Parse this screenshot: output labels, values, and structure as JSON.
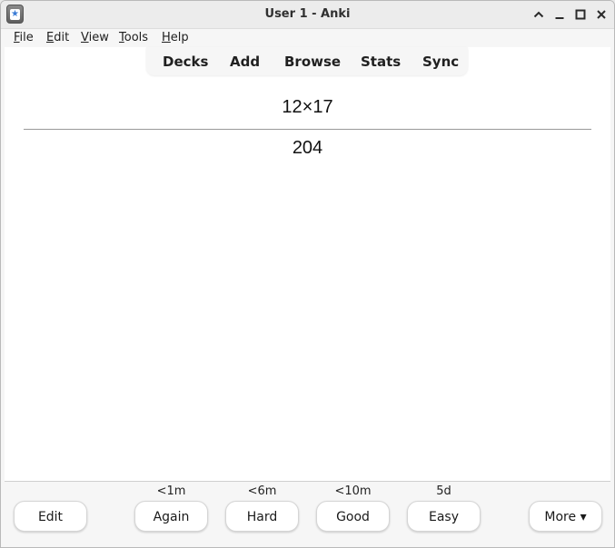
{
  "window": {
    "title": "User 1 - Anki"
  },
  "menubar": {
    "items": [
      {
        "label_u": "F",
        "label_rest": "ile"
      },
      {
        "label_u": "E",
        "label_rest": "dit"
      },
      {
        "label_u": "V",
        "label_rest": "iew"
      },
      {
        "label_u": "T",
        "label_rest": "ools"
      },
      {
        "label_u": "H",
        "label_rest": "elp"
      }
    ]
  },
  "toptabs": [
    "Decks",
    "Add",
    "Browse",
    "Stats",
    "Sync"
  ],
  "card": {
    "question": "12×17",
    "answer": "204"
  },
  "bottom": {
    "edit_label": "Edit",
    "answers": [
      {
        "interval": "<1m",
        "label": "Again"
      },
      {
        "interval": "<6m",
        "label": "Hard"
      },
      {
        "interval": "<10m",
        "label": "Good"
      },
      {
        "interval": "5d",
        "label": "Easy"
      }
    ],
    "more_label": "More ▾"
  },
  "icons": {
    "app": "anki-app-icon",
    "chevron_up": "chevron-up-icon",
    "minimize": "minimize-icon",
    "maximize": "maximize-icon",
    "close": "close-icon"
  }
}
